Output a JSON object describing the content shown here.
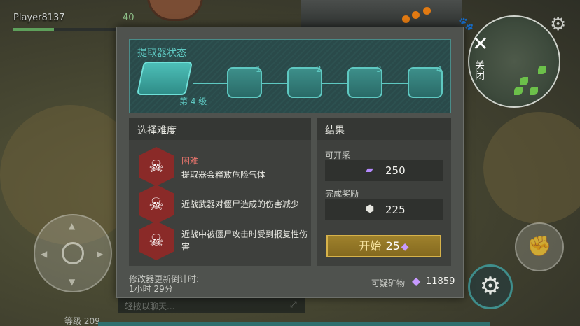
{
  "hud": {
    "player_name": "Player8137",
    "health": "40",
    "health_fraction": 0.34,
    "level_label": "等级 209",
    "chat_placeholder": "轻按以聊天..."
  },
  "minimap": {
    "close_label": "关闭",
    "close_icon": "close-icon",
    "settings_icon": "gear-icon"
  },
  "panel": {
    "status_title": "提取器状态",
    "extractor_level": "第 4 级",
    "nodes": [
      "1",
      "2",
      "3",
      "4"
    ],
    "difficulty": {
      "title": "选择难度",
      "hard_label": "困难",
      "modifiers": [
        {
          "text": "提取器会释放危险气体",
          "icon": "skull-plus-icon"
        },
        {
          "text": "近战武器对僵尸造成的伤害减少",
          "icon": "skull-burst-icon"
        },
        {
          "text": "近战中被僵尸攻击时受到报复性伤害",
          "icon": "skull-shield-icon"
        }
      ]
    },
    "result": {
      "title": "结果",
      "mineable_label": "可开采",
      "mineable_value": "250",
      "reward_label": "完成奖励",
      "reward_value": "225",
      "start_label": "开始",
      "start_cost": "25"
    },
    "timer": {
      "label": "修改器更新倒计时:",
      "value": "1小时 29分"
    },
    "crystal": {
      "label": "可疑矿物",
      "value": "11859"
    }
  },
  "colors": {
    "accent_teal": "#5ec8c1",
    "danger_red": "#8a2a28",
    "start_gold": "#d6b24a"
  }
}
